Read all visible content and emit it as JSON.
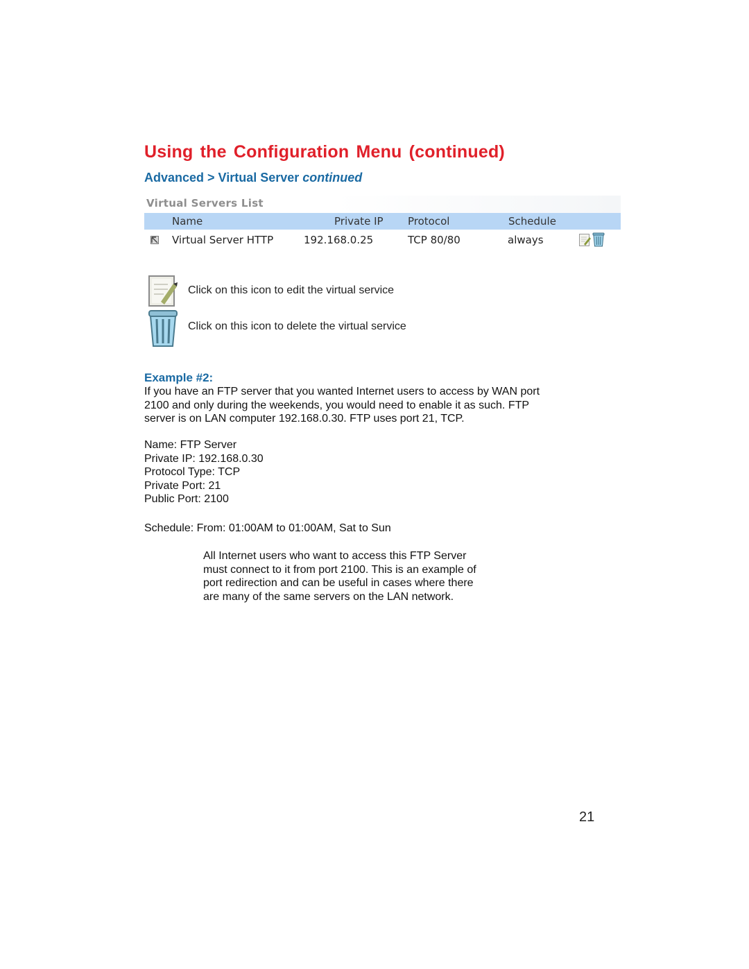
{
  "page": {
    "title": "Using the Configuration Menu (continued)",
    "subtitle_main": "Advanced > Virtual Server",
    "subtitle_italic": "continued",
    "page_number": "21"
  },
  "virtual_servers_list": {
    "title": "Virtual Servers List",
    "columns": [
      "Name",
      "Private IP",
      "Protocol",
      "Schedule"
    ],
    "rows": [
      {
        "checked": true,
        "name": "Virtual Server HTTP",
        "private_ip": "192.168.0.25",
        "protocol": "TCP 80/80",
        "schedule": "always",
        "actions": [
          "edit-icon",
          "trash-icon"
        ]
      }
    ],
    "header_color": "#b8d6f5"
  },
  "icon_legend": [
    {
      "icon": "edit-icon",
      "text": "Click on this icon to edit the virtual service"
    },
    {
      "icon": "trash-icon",
      "text": "Click on this icon to delete the virtual service"
    }
  ],
  "example": {
    "title": "Example #2:",
    "intro_lines": [
      "If you have an FTP server that you wanted Internet users to access by WAN port",
      "2100 and only during the weekends, you would need to enable it as such. FTP",
      "server is on LAN computer 192.168.0.30. FTP uses port 21, TCP."
    ],
    "settings": [
      "Name: FTP Server",
      "Private IP: 192.168.0.30",
      "Protocol Type: TCP",
      "Private Port: 21",
      "Public Port: 2100"
    ],
    "schedule": "Schedule: From: 01:00AM to 01:00AM, Sat to Sun",
    "note_lines": [
      "All Internet users who want to access this FTP Server",
      "must connect to it from port 2100. This is an example of",
      "port redirection and can be useful in cases where there",
      "are many of the same servers on the LAN network."
    ]
  },
  "colors": {
    "title_red": "#e0202a",
    "heading_blue": "#1a6aa3"
  }
}
